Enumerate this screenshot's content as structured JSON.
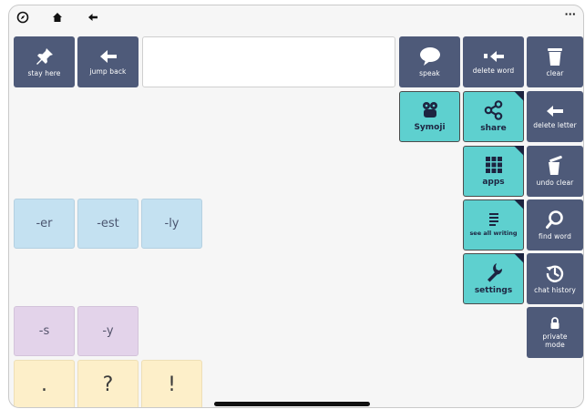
{
  "topbar": {
    "left_icons": [
      "compass-icon",
      "home-icon",
      "back-arrow-icon"
    ],
    "more_label": "···"
  },
  "message_bar": {
    "value": ""
  },
  "buttons": {
    "stay_here": "stay here",
    "jump_back": "jump back",
    "speak": "speak",
    "delete_word": "delete word",
    "clear": "clear",
    "symoji": "Symoji",
    "share": "share",
    "delete_letter": "delete letter",
    "apps": "apps",
    "undo_clear": "undo clear",
    "see_all_writing": "see all writing",
    "find_word": "find word",
    "settings": "settings",
    "chat_history": "chat history",
    "private_mode": "private mode"
  },
  "suffix_tiles": [
    "-er",
    "-est",
    "-ly"
  ],
  "suffix_tiles_2": [
    "-s",
    "-y"
  ],
  "punctuation_tiles": [
    ".",
    "?",
    "!"
  ],
  "colors": {
    "dark_button": "#4e5a79",
    "teal_button": "#5ed0cf",
    "suffix_blue": "#c4e1f1",
    "suffix_purple": "#e3d3ea",
    "punctuation_yellow": "#fdefc9"
  }
}
